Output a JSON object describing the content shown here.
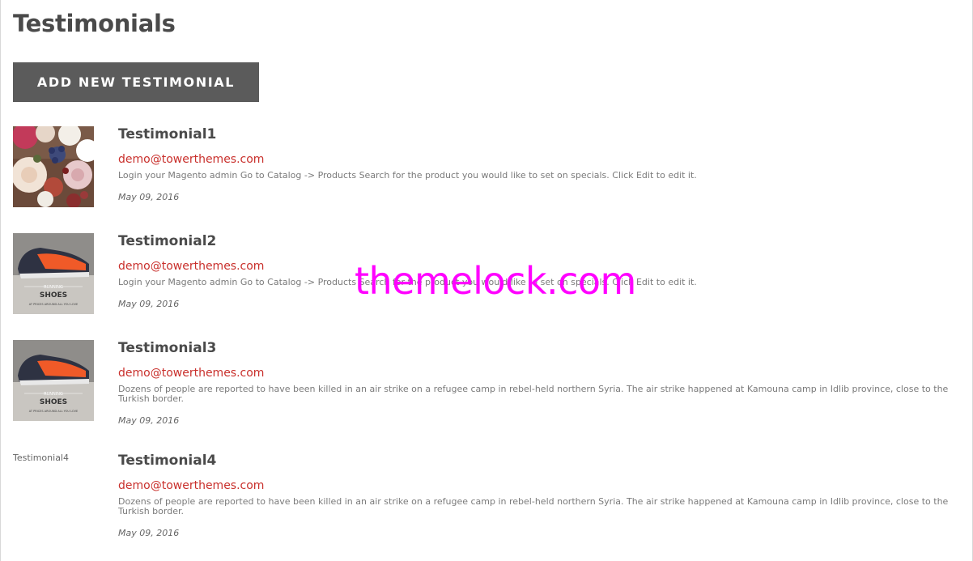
{
  "page": {
    "title": "Testimonials",
    "add_button_label": "ADD NEW TESTIMONIAL"
  },
  "testimonials": [
    {
      "name": "Testimonial1",
      "email": "demo@towerthemes.com",
      "text": "Login your Magento admin Go to Catalog -> Products Search for the product you would like to set on specials. Click Edit to edit it.",
      "date": "May 09, 2016",
      "image": "flower-bouquet"
    },
    {
      "name": "Testimonial2",
      "email": "demo@towerthemes.com",
      "text": "Login your Magento admin Go to Catalog -> Products Search for the product you would like to set on specials. Click Edit to edit it.",
      "date": "May 09, 2016",
      "image": "running-shoes",
      "image_caption_top": "RUNNING",
      "image_caption_main": "SHOES",
      "image_caption_sub": "AT PRICES AROUND ALL YOU LOVE"
    },
    {
      "name": "Testimonial3",
      "email": "demo@towerthemes.com",
      "text": "Dozens of people are reported to have been killed in an air strike on a refugee camp in rebel-held northern Syria. The air strike happened at Kamouna camp in Idlib province, close to the Turkish border.",
      "date": "May 09, 2016",
      "image": "running-shoes",
      "image_caption_top": "RUNNING",
      "image_caption_main": "SHOES",
      "image_caption_sub": "AT PRICES AROUND ALL YOU LOVE"
    },
    {
      "name": "Testimonial4",
      "email": "demo@towerthemes.com",
      "text": "Dozens of people are reported to have been killed in an air strike on a refugee camp in rebel-held northern Syria. The air strike happened at Kamouna camp in Idlib province, close to the Turkish border.",
      "date": "May 09, 2016",
      "image_alt": "Testimonial4"
    }
  ],
  "watermark": "themelock.com",
  "colors": {
    "button_bg": "#5b5b5b",
    "email": "#c9302c",
    "watermark": "#ff00ff"
  }
}
